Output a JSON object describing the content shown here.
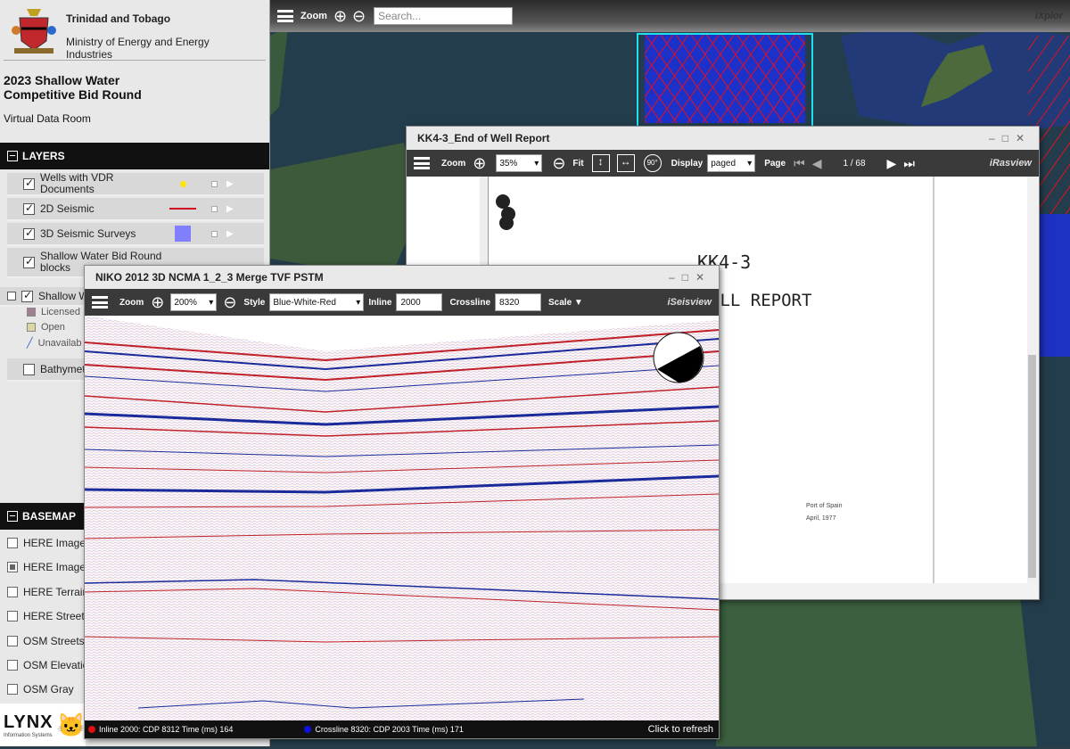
{
  "sidebar": {
    "org_country": "Trinidad and Tobago",
    "org_ministry": "Ministry of Energy and Energy Industries",
    "title": "2023 Shallow Water Competitive Bid Round",
    "subtitle": "Virtual Data Room",
    "layers_title": "LAYERS",
    "layers": [
      {
        "label": "Wells with VDR Documents",
        "checked": true
      },
      {
        "label": "2D Seismic",
        "checked": true
      },
      {
        "label": "3D Seismic Surveys",
        "checked": true
      },
      {
        "label": "Shallow Water Bid Round blocks",
        "checked": true
      },
      {
        "label": "Shallow W",
        "checked": true
      },
      {
        "label": "Bathymet",
        "checked": false
      }
    ],
    "legend": [
      "Licensed",
      "Open",
      "Unavailab"
    ],
    "basemap_title": "BASEMAP",
    "basemaps": [
      {
        "label": "HERE Image",
        "selected": false
      },
      {
        "label": "HERE Image",
        "selected": true
      },
      {
        "label": "HERE Terrain",
        "selected": false
      },
      {
        "label": "HERE Street",
        "selected": false
      },
      {
        "label": "OSM Streets",
        "selected": false
      },
      {
        "label": "OSM Elevatio",
        "selected": false
      },
      {
        "label": "OSM Gray",
        "selected": false
      }
    ],
    "logo": "LYNX",
    "logo_sub": "Information Systems"
  },
  "map_toolbar": {
    "zoom_label": "Zoom",
    "search_placeholder": "Search...",
    "brand": "iXplor"
  },
  "report_window": {
    "title": "KK4-3_End of Well Report",
    "zoom_label": "Zoom",
    "zoom_value": "35%",
    "fit_label": "Fit",
    "rotate_label": "90°",
    "display_label": "Display",
    "display_value": "paged",
    "page_label": "Page",
    "page_value": "1 / 68",
    "brand": "iRasview",
    "doc_heading": "KK4-3",
    "doc_heading2": "ELL REPORT",
    "doc_place": "Port of Spain",
    "doc_date": "April, 1977"
  },
  "seismic_window": {
    "title": "NIKO 2012 3D NCMA 1_2_3 Merge TVF PSTM",
    "zoom_label": "Zoom",
    "zoom_value": "200%",
    "style_label": "Style",
    "style_value": "Blue-White-Red",
    "inline_label": "Inline",
    "inline_value": "2000",
    "crossline_label": "Crossline",
    "crossline_value": "8320",
    "scale_label": "Scale ▼",
    "brand": "iSeisview",
    "status_inline": "Inline 2000: CDP 8312 Time (ms) 164",
    "status_crossline": "Crossline 8320: CDP 2003 Time (ms) 171",
    "refresh": "Click to refresh"
  },
  "colors": {
    "accent_dark": "#111111",
    "seismic_red": "#c0202a",
    "seismic_blue": "#1a2a9a"
  }
}
